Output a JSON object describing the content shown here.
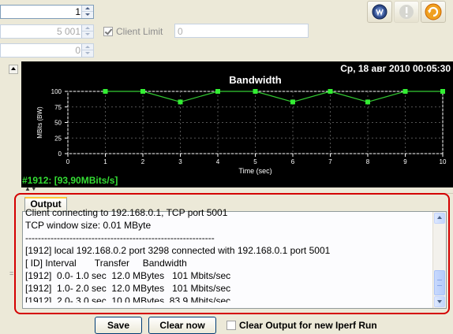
{
  "form": {
    "spinner1_value": "1",
    "spinner2_value": "5 001",
    "spinner3_value": "0",
    "client_limit_label": "Client Limit",
    "client_limit_checked": true,
    "client_limit_value": "0"
  },
  "chart_panel": {
    "timestamp": "Ср, 18 авг 2010 00:05:30",
    "status": "#1912: [93,90MBits/s]"
  },
  "chart_data": {
    "type": "line",
    "title": "Bandwidth",
    "xlabel": "Time (sec)",
    "ylabel": "MBits (BW)",
    "xlim": [
      0,
      10
    ],
    "ylim": [
      0,
      100
    ],
    "xticks": [
      "0",
      "1",
      "2",
      "3",
      "4",
      "5",
      "6",
      "7",
      "8",
      "9",
      "10"
    ],
    "yticks": [
      "0",
      "25",
      "50",
      "75",
      "100"
    ],
    "grid": true,
    "colors": {
      "background": "#000000",
      "line": "#33cc33",
      "marker": "#33ee33",
      "axes": "#ffffff",
      "grid": "#555555"
    },
    "series": [
      {
        "x": [
          1,
          2,
          3,
          4,
          5,
          6,
          7,
          8,
          9,
          10
        ],
        "values": [
          100,
          100,
          83,
          100,
          100,
          83,
          100,
          83,
          100,
          100
        ]
      }
    ]
  },
  "output": {
    "tab_label": "Output",
    "lines": [
      "Client connecting to 192.168.0.1, TCP port 5001",
      "TCP window size: 0.01 MByte",
      "------------------------------------------------------------",
      "[1912] local 192.168.0.2 port 3298 connected with 192.168.0.1 port 5001",
      "[ ID] Interval       Transfer     Bandwidth",
      "[1912]  0.0- 1.0 sec  12.0 MBytes   101 Mbits/sec",
      "[1912]  1.0- 2.0 sec  12.0 MBytes   101 Mbits/sec",
      "[1912]  2.0- 3.0 sec  10.0 MBytes  83.9 Mbits/sec"
    ]
  },
  "buttons": {
    "save_label": "Save",
    "clear_label": "Clear now",
    "clear_on_run_label": "Clear Output for new Iperf Run"
  },
  "icons": {
    "toolbar": [
      "run-icon",
      "stop-icon",
      "refresh-icon"
    ]
  }
}
